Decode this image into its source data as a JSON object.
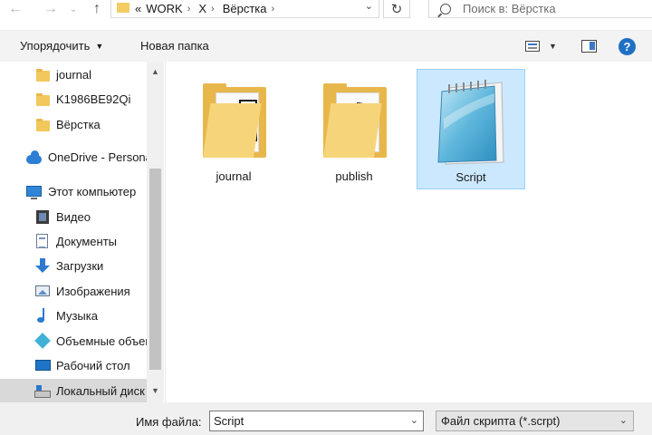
{
  "address_bar": {
    "overflow": "«",
    "crumbs": [
      "WORK",
      "X",
      "Вёрстка"
    ],
    "search_placeholder": "Поиск в: Вёрстка"
  },
  "toolbar": {
    "organize_label": "Упорядочить",
    "new_folder_label": "Новая папка"
  },
  "sidebar": {
    "items": [
      {
        "label": "journal",
        "icon": "folder-icon"
      },
      {
        "label": "K1986BE92Qi",
        "icon": "folder-icon"
      },
      {
        "label": "Вёрстка",
        "icon": "folder-icon"
      },
      {
        "label": "OneDrive - Personal",
        "icon": "onedrive-icon"
      },
      {
        "label": "Этот компьютер",
        "icon": "computer-icon"
      },
      {
        "label": "Видео",
        "icon": "video-icon"
      },
      {
        "label": "Документы",
        "icon": "documents-icon"
      },
      {
        "label": "Загрузки",
        "icon": "downloads-icon"
      },
      {
        "label": "Изображения",
        "icon": "pictures-icon"
      },
      {
        "label": "Музыка",
        "icon": "music-icon"
      },
      {
        "label": "Объемные объекты",
        "icon": "3d-objects-icon"
      },
      {
        "label": "Рабочий стол",
        "icon": "desktop-icon"
      },
      {
        "label": "Локальный диск (C:)",
        "icon": "drive-icon"
      }
    ]
  },
  "content": {
    "items": [
      {
        "name": "journal",
        "type": "folder"
      },
      {
        "name": "publish",
        "type": "folder"
      },
      {
        "name": "Script",
        "type": "text-file",
        "selected": true
      }
    ]
  },
  "bottom": {
    "filename_label": "Имя файла:",
    "filename_value": "Script",
    "filetype_value": "Файл скрипта (*.scrpt)"
  },
  "colors": {
    "accent": "#1f6fc5",
    "selection": "#cce8ff",
    "folder": "#f2c75c"
  }
}
